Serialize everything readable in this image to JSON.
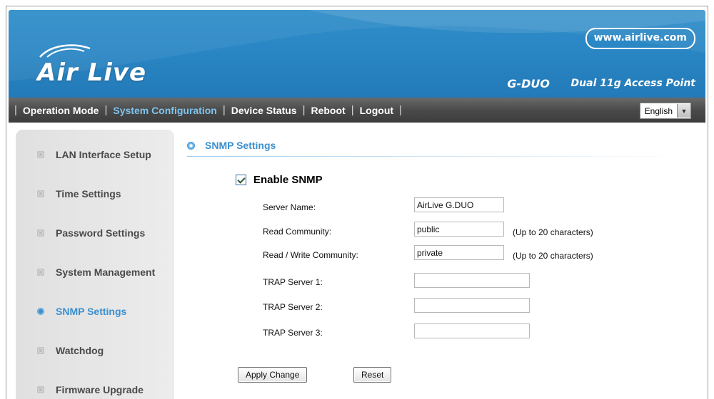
{
  "header": {
    "brand": "Air Live",
    "url": "www.airlive.com",
    "model": "G-DUO",
    "tagline": "Dual 11g Access Point"
  },
  "nav": {
    "items": [
      {
        "label": "Operation Mode",
        "active": false
      },
      {
        "label": "System Configuration",
        "active": true
      },
      {
        "label": "Device Status",
        "active": false
      },
      {
        "label": "Reboot",
        "active": false
      },
      {
        "label": "Logout",
        "active": false
      }
    ],
    "language": "English"
  },
  "sidebar": {
    "items": [
      {
        "label": "LAN Interface Setup",
        "active": false
      },
      {
        "label": "Time Settings",
        "active": false
      },
      {
        "label": "Password Settings",
        "active": false
      },
      {
        "label": "System Management",
        "active": false
      },
      {
        "label": "SNMP Settings",
        "active": true
      },
      {
        "label": "Watchdog",
        "active": false
      },
      {
        "label": "Firmware Upgrade",
        "active": false
      }
    ]
  },
  "main": {
    "section_title": "SNMP Settings",
    "enable_label": "Enable SNMP",
    "enable_checked": true,
    "fields": [
      {
        "label": "Server Name:",
        "value": ""
      },
      {
        "label": "Read Community:",
        "value": "public",
        "hint": "(Up to 20 characters)"
      },
      {
        "label": "Read / Write Community:",
        "value": "private",
        "hint": "(Up to 20 characters)"
      },
      {
        "label": "TRAP Server 1:",
        "value": ""
      },
      {
        "label": "TRAP Server 2:",
        "value": ""
      },
      {
        "label": "TRAP Server 3:",
        "value": ""
      }
    ],
    "server_name_value": "AirLive G.DUO",
    "apply_label": "Apply Change",
    "reset_label": "Reset"
  },
  "colors": {
    "header_blue": "#2a86c4",
    "nav_dark": "#4a4a4a",
    "active_blue": "#3a8fd0"
  }
}
